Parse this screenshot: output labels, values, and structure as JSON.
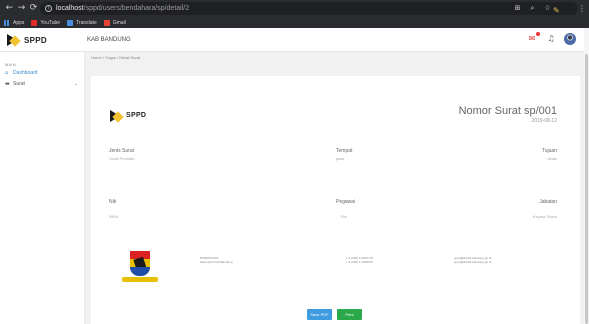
{
  "browser": {
    "back": "←",
    "forward": "→",
    "reload": "⟳",
    "url_host": "localhost",
    "url_path": "/sppd/users/bendahara/sp/detail/2",
    "bookmarks": [
      {
        "label": "Apps"
      },
      {
        "label": "YouTube"
      },
      {
        "label": "Translate"
      },
      {
        "label": "Gmail"
      }
    ]
  },
  "header": {
    "brand": "SPPD",
    "title": "KAB BANDUNG"
  },
  "sidebar": {
    "menu_label": "MAIN",
    "items": [
      {
        "label": "Dashboard",
        "icon": "home-icon"
      },
      {
        "label": "Surat",
        "icon": "file-icon"
      }
    ]
  },
  "breadcrumb": "Home / Tugas / Detail Surat",
  "document": {
    "brand": "SPPD",
    "title": "Nomor Surat sp/001",
    "date": "2019-08-12",
    "jenis_label": "Jenis Surat",
    "jenis_value": "Surat Perintah",
    "tempat_label": "Tempat",
    "tempat_value": "jawa",
    "tujuan_label": "Tujuan",
    "tujuan_value": "dinas",
    "nik_label": "Nik",
    "nik_value": "0909",
    "pegawai_label": "Pegawai",
    "pegawai_value": "Roi",
    "jabatan_label": "Jabatan",
    "jabatan_value": "Kepala Sekar",
    "footer_org_1": "DISDIKPORA",
    "footer_org_2": "Sekretaris Kab Bandung",
    "footer_phone_1": "+ 6 (026) 5 0901776",
    "footer_phone_2": "+ 6 (026) 1 0906907",
    "footer_mail_1": "sppd@disdik-bandung.go.id",
    "footer_mail_2": "sppd@disdik-bandung.go.id",
    "save_pdf": "Save PDF",
    "print": "Print"
  }
}
